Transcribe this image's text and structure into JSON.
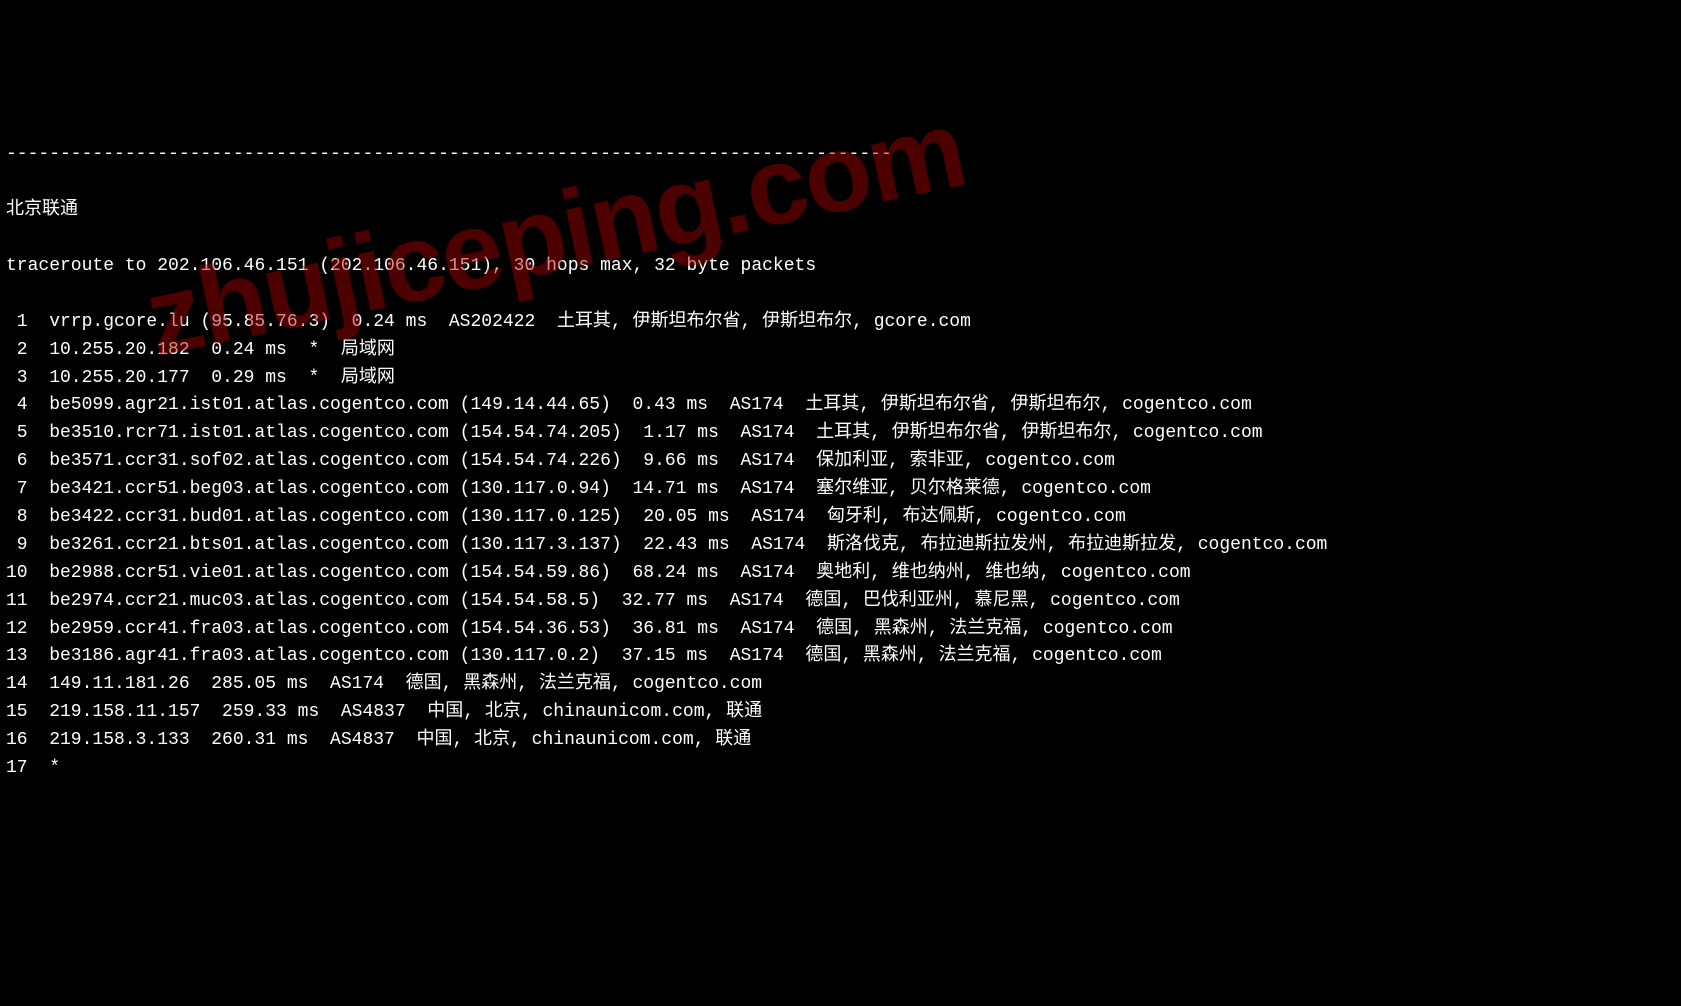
{
  "divider": "----------------------------------------------------------------------------------",
  "title": "北京联通",
  "trace_header": "traceroute to 202.106.46.151 (202.106.46.151), 30 hops max, 32 byte packets",
  "watermark": "zhujiceping.com",
  "hops": [
    {
      "n": "1",
      "rest": "  vrrp.gcore.lu (95.85.76.3)  0.24 ms  AS202422  土耳其, 伊斯坦布尔省, 伊斯坦布尔, gcore.com"
    },
    {
      "n": "2",
      "rest": "  10.255.20.182  0.24 ms  *  局域网"
    },
    {
      "n": "3",
      "rest": "  10.255.20.177  0.29 ms  *  局域网"
    },
    {
      "n": "4",
      "rest": "  be5099.agr21.ist01.atlas.cogentco.com (149.14.44.65)  0.43 ms  AS174  土耳其, 伊斯坦布尔省, 伊斯坦布尔, cogentco.com"
    },
    {
      "n": "5",
      "rest": "  be3510.rcr71.ist01.atlas.cogentco.com (154.54.74.205)  1.17 ms  AS174  土耳其, 伊斯坦布尔省, 伊斯坦布尔, cogentco.com"
    },
    {
      "n": "6",
      "rest": "  be3571.ccr31.sof02.atlas.cogentco.com (154.54.74.226)  9.66 ms  AS174  保加利亚, 索非亚, cogentco.com"
    },
    {
      "n": "7",
      "rest": "  be3421.ccr51.beg03.atlas.cogentco.com (130.117.0.94)  14.71 ms  AS174  塞尔维亚, 贝尔格莱德, cogentco.com"
    },
    {
      "n": "8",
      "rest": "  be3422.ccr31.bud01.atlas.cogentco.com (130.117.0.125)  20.05 ms  AS174  匈牙利, 布达佩斯, cogentco.com"
    },
    {
      "n": "9",
      "rest": "  be3261.ccr21.bts01.atlas.cogentco.com (130.117.3.137)  22.43 ms  AS174  斯洛伐克, 布拉迪斯拉发州, 布拉迪斯拉发, cogentco.com"
    },
    {
      "n": "10",
      "rest": "  be2988.ccr51.vie01.atlas.cogentco.com (154.54.59.86)  68.24 ms  AS174  奥地利, 维也纳州, 维也纳, cogentco.com"
    },
    {
      "n": "11",
      "rest": "  be2974.ccr21.muc03.atlas.cogentco.com (154.54.58.5)  32.77 ms  AS174  德国, 巴伐利亚州, 慕尼黑, cogentco.com"
    },
    {
      "n": "12",
      "rest": "  be2959.ccr41.fra03.atlas.cogentco.com (154.54.36.53)  36.81 ms  AS174  德国, 黑森州, 法兰克福, cogentco.com"
    },
    {
      "n": "13",
      "rest": "  be3186.agr41.fra03.atlas.cogentco.com (130.117.0.2)  37.15 ms  AS174  德国, 黑森州, 法兰克福, cogentco.com"
    },
    {
      "n": "14",
      "rest": "  149.11.181.26  285.05 ms  AS174  德国, 黑森州, 法兰克福, cogentco.com"
    },
    {
      "n": "15",
      "rest": "  219.158.11.157  259.33 ms  AS4837  中国, 北京, chinaunicom.com, 联通"
    },
    {
      "n": "16",
      "rest": "  219.158.3.133  260.31 ms  AS4837  中国, 北京, chinaunicom.com, 联通"
    },
    {
      "n": "17",
      "rest": "  *"
    }
  ]
}
